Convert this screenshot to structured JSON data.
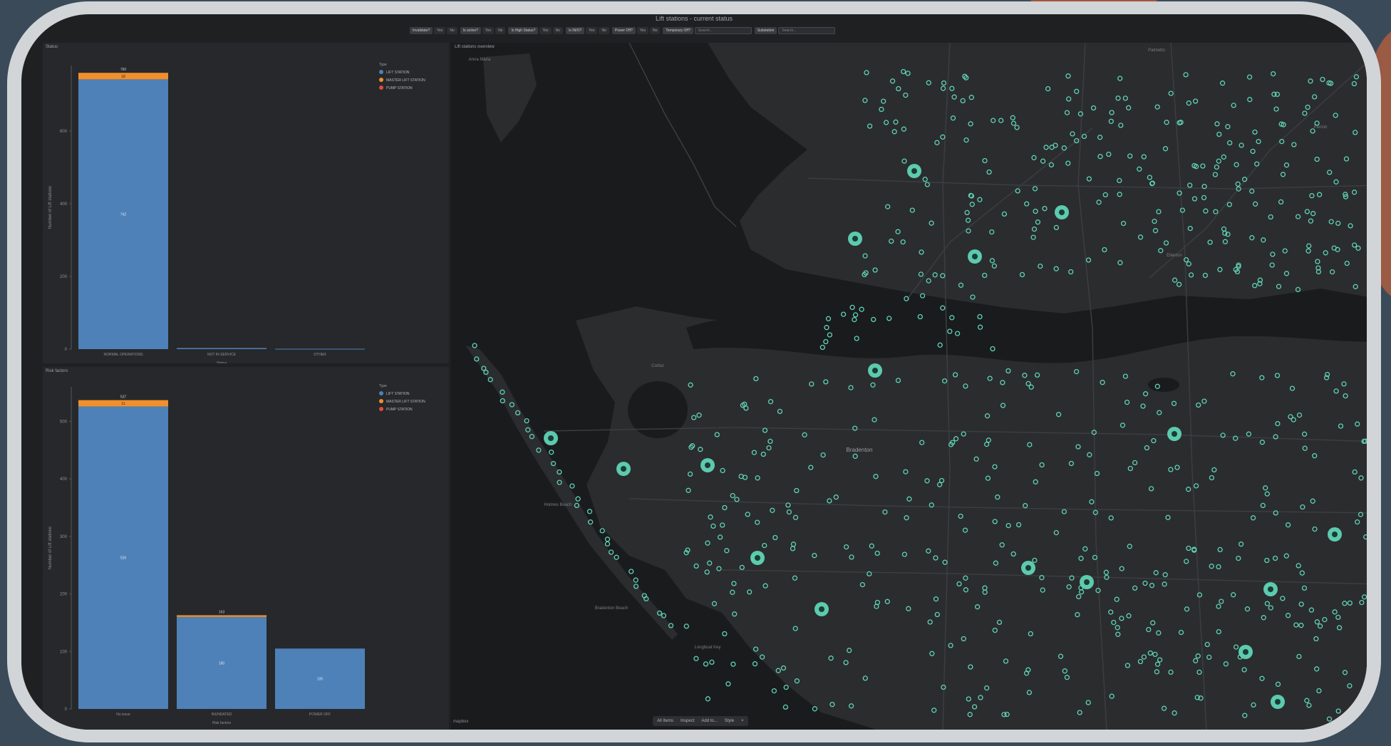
{
  "app": {
    "title": "Lift stations - current status"
  },
  "filters": [
    {
      "label": "Invalidate?",
      "options": [
        "Yes",
        "No"
      ]
    },
    {
      "label": "Is active?",
      "options": [
        "Yes",
        "No"
      ]
    },
    {
      "label": "Is High Status?",
      "options": [
        "Yes",
        "No"
      ]
    },
    {
      "label": "Is IN/O?",
      "options": [
        "Yes",
        "No"
      ]
    },
    {
      "label": "Power Off?",
      "options": [
        "Yes",
        "No"
      ]
    },
    {
      "label": "Temporary Off?",
      "select_placeholder": "Search..."
    },
    {
      "label": "Substation",
      "select_placeholder": "Search..."
    }
  ],
  "chart_data": [
    {
      "type": "bar",
      "title": "Status",
      "xlabel": "Status",
      "ylabel": "Number of Lift stations",
      "categories": [
        "NORMAL OPERATIONS",
        "NOT IN SERVICE",
        "OTHER"
      ],
      "yticks": [
        0,
        200,
        400,
        600
      ],
      "ylim": [
        0,
        780
      ],
      "series": [
        {
          "name": "LIFT STATION",
          "values": [
            742,
            3,
            1
          ]
        },
        {
          "name": "MASTER LIFT STATION",
          "values": [
            18,
            0,
            0
          ]
        },
        {
          "name": "PUMP STATION",
          "values": [
            0,
            0,
            0
          ]
        }
      ],
      "totals": [
        "760",
        "",
        ""
      ],
      "segment_labels": {
        "LIFT STATION": [
          "742",
          "",
          ""
        ],
        "MASTER LIFT STATION": [
          "18",
          "",
          ""
        ]
      },
      "legend": {
        "title": "Type",
        "position": "top-right"
      },
      "colors": [
        "#4e81b8",
        "#f18f2c",
        "#e5493a"
      ]
    },
    {
      "type": "bar",
      "title": "Risk factors",
      "xlabel": "Risk factors",
      "ylabel": "Number of Lift stations",
      "categories": [
        "No issue",
        "INUNDATED",
        "POWER OFF"
      ],
      "yticks": [
        0,
        100,
        200,
        300,
        400,
        500
      ],
      "ylim": [
        0,
        560
      ],
      "series": [
        {
          "name": "LIFT STATION",
          "values": [
            526,
            160,
            105
          ]
        },
        {
          "name": "MASTER LIFT STATION",
          "values": [
            11,
            3,
            0
          ]
        },
        {
          "name": "PUMP STATION",
          "values": [
            0,
            0,
            0
          ]
        }
      ],
      "totals": [
        "537",
        "163",
        ""
      ],
      "segment_labels": {
        "LIFT STATION": [
          "526",
          "160",
          "105"
        ],
        "MASTER LIFT STATION": [
          "11",
          "",
          ""
        ]
      },
      "legend": {
        "title": "Type",
        "position": "top-right"
      },
      "colors": [
        "#4e81b8",
        "#f18f2c",
        "#e5493a"
      ]
    }
  ],
  "map": {
    "title": "Lift stations overview",
    "city_label": "Bradenton",
    "places": [
      "Longboat Key",
      "Palmetto",
      "Anna Maria",
      "Holmes Beach",
      "Bradenton Beach",
      "Ellenton",
      "Parrish",
      "Cortez"
    ],
    "marker_color": "#5fd3b5",
    "attribution": "mapbox",
    "toolbar": [
      "All Items",
      "Inspect",
      "Add to...",
      "Style"
    ]
  }
}
